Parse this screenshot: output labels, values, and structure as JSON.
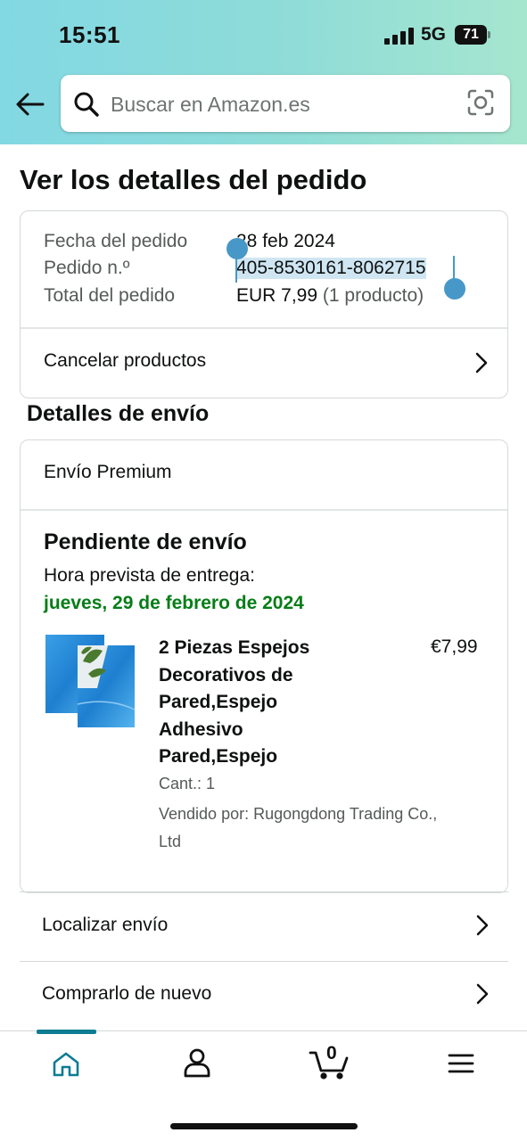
{
  "status_bar": {
    "time": "15:51",
    "network": "5G",
    "battery": "71"
  },
  "search": {
    "placeholder": "Buscar en Amazon.es"
  },
  "page_title": "Ver los detalles del pedido",
  "order_summary": {
    "date_label": "Fecha del pedido",
    "date_value": "28 feb 2024",
    "number_label": "Pedido n.º",
    "number_value": "405-8530161-8062715",
    "total_label": "Total del pedido",
    "total_value": "EUR 7,99",
    "total_count": "(1 producto)",
    "cancel_label": "Cancelar productos"
  },
  "shipping": {
    "section_title": "Detalles de envío",
    "method": "Envío Premium",
    "status": "Pendiente de envío",
    "eta_label": "Hora prevista de entrega:",
    "eta_date": "jueves, 29 de febrero de 2024",
    "item": {
      "title_lines": [
        "2 Piezas Espejos",
        "Decorativos de",
        "Pared,Espejo",
        "Adhesivo",
        "Pared,Espejo"
      ],
      "price": "€7,99",
      "quantity": "Cant.: 1",
      "seller_lines": [
        "Vendido por: Rugongdong Trading Co.,",
        "Ltd"
      ]
    }
  },
  "links": {
    "track": "Localizar envío",
    "buy_again": "Comprarlo de nuevo"
  },
  "tabbar": {
    "cart_count": "0"
  },
  "colors": {
    "accent": "#0e7c91",
    "green": "#067d17",
    "selection": "#4798c8"
  }
}
